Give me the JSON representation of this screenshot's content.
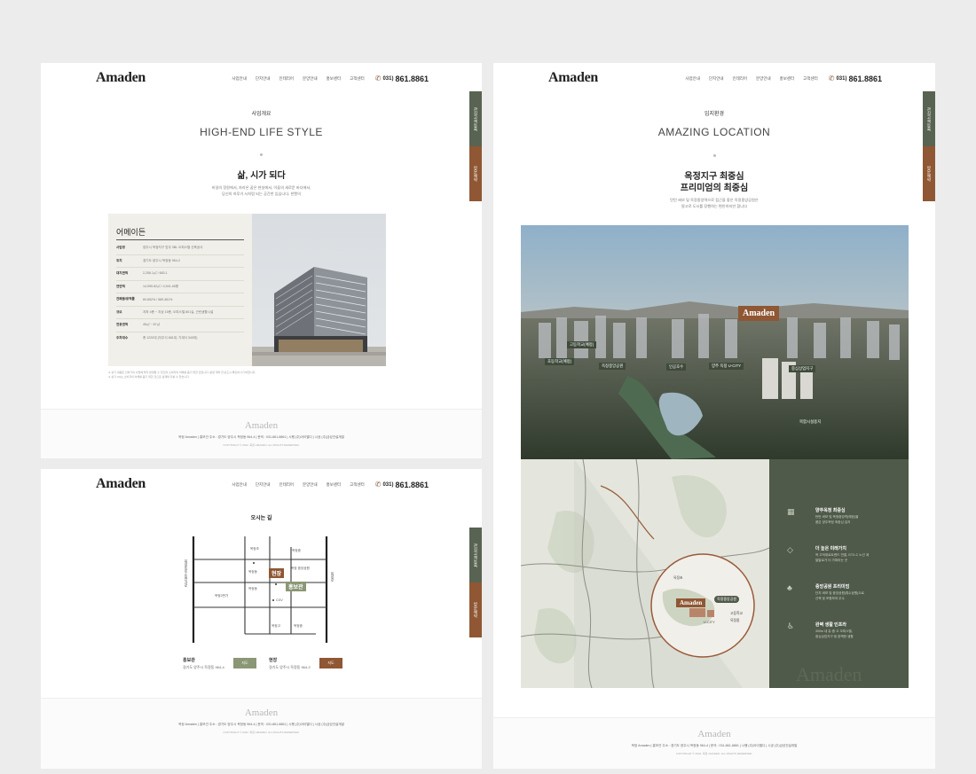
{
  "brand": {
    "logo": "Amaden",
    "nav": [
      "사업안내",
      "단지안내",
      "인테리어",
      "분양안내",
      "홍보센터",
      "고객센터"
    ],
    "phone_prefix": "031)",
    "phone_number": "861.8861"
  },
  "side_tabs": [
    "관심고객등록",
    "방문예약"
  ],
  "footer": {
    "logo": "Amaden",
    "info": "옥정 Amaden  |  홍보관 주소 : 경기도 양주시 옥정동 964-4  |  문의 : 031-861-8861  |  시행 (주)아이엘디  |  시공 (주)금성건설개발",
    "copyright": "COPYRIGHT © 2022. 옥정 AMADEN. ALL RIGHTS RESERVED."
  },
  "page1": {
    "section_label": "사업개요",
    "section_title": "HIGH-END LIFE STYLE",
    "headline": "삶, 시가 되다",
    "subtext": [
      "비일의 정원에서, 자라온 꿈은 현실에서, 이들의 새로운 바다에서,",
      "당신의 하루가 시처럼 되는 공간한 입습니다. 한캔의"
    ],
    "box_title": "어메이든",
    "rows": [
      {
        "k": "사업명",
        "v": "양주시 옥정지구 업무 3BL 오피스텔 신축공사"
      },
      {
        "k": "위치",
        "v": "경기도 양주시 옥정동 964-2"
      },
      {
        "k": "대지면적",
        "v": "2,256.1㎡ / 683.1"
      },
      {
        "k": "연면적",
        "v": "14,995.62㎡ / 4,541.46평"
      },
      {
        "k": "건폐율/용적률",
        "v": "69.652% / 589.481%"
      },
      {
        "k": "규모",
        "v": "지하 4층 ~ 지상 15층, 오피스텔 801실, 근린생활시설"
      },
      {
        "k": "전용면적",
        "v": "45㎡ ~ 67㎡"
      },
      {
        "k": "주차대수",
        "v": "총 1220대 (자주식 681대, 기계식 340대)"
      }
    ],
    "notes": [
      "※ 상기 내용은 인허가의 사업에 따라 변경될 수 있으며 소비자의 이해를 돕기 위한 것입니다. 분양 계약 전 반드시 확인하시기 바랍니다.",
      "※ 상기 CG는 소비자의 이해를 돕기 위한 것으로 실제와 다를 수 있습니다."
    ]
  },
  "page2": {
    "title": "오시는 길",
    "map_labels": {
      "site": "현장",
      "gallery": "홍보관",
      "left_road": "옥정동로-동안가로",
      "right_road": "옥정로",
      "top_a": "옥정초",
      "top_b": "옥정중",
      "park": "옥정 중앙공원",
      "left_place": "옥정2번가",
      "mid_place": "옥정동",
      "mid_place2": "옥정동",
      "bottom_a": "옥정고",
      "bottom_b": "옥정중",
      "cgv": "CGV"
    },
    "gallery": {
      "title": "홍보관",
      "address": "경기도 양주시 옥정동 964-4",
      "button": "지도"
    },
    "site": {
      "title": "현장",
      "address": "경기도 양주시 옥정동 964-2",
      "button": "지도"
    }
  },
  "page3": {
    "section_label": "입지환경",
    "section_title": "AMAZING LOCATION",
    "headline": [
      "옥정지구 최중심",
      "프리미엄의 최중심"
    ],
    "subtext": [
      "탄탄 써보 및 옥정중앙역으로 접근을 좋은 옥정중앙공원은",
      "말고로 도시를 장행하는 편안하지만 합니다"
    ],
    "aerial_logo": "Amaden",
    "aerial_labels": [
      "고등학교(예정)",
      "초등학교(예정)",
      "옥정중앙공원",
      "인공호수",
      "양주 옥정 U-CITY",
      "중심상업지구",
      "복합시설용지"
    ],
    "map_logo": "Amaden",
    "map_labels": [
      "옥정중앙공원",
      "옥정초",
      "고등학교",
      "U-CITY",
      "옥정중"
    ],
    "features": [
      {
        "icon": "city-icon",
        "title": "양주옥정 최중심",
        "desc": [
          "탄탄 써보 및 옥정중앙역(예정)을",
          "품은 양주옥정 최중심 입지"
        ]
      },
      {
        "icon": "gem-icon",
        "title": "더 높은 미래가치",
        "desc": [
          "옥 고덕위로트렌드 연결, GTX-C 노선 계",
          "발발로가 더 가파라는 곳"
        ]
      },
      {
        "icon": "park-icon",
        "title": "중앙공원 프리미엄",
        "desc": [
          "단지 써보 및 중앙공원(휴수공원)으로",
          "산책 및 포함하여 우수"
        ]
      },
      {
        "icon": "stroller-icon",
        "title": "완벽 생활 인프라",
        "desc": [
          "300m 내 유·중·고 오피스텔,",
          "중심상업지구 등 완벽한 생활"
        ]
      }
    ],
    "watermark": "Amaden"
  },
  "colors": {
    "green": "#596352",
    "brown": "#8f5734",
    "panel": "#4f5a4a",
    "beige": "#f0efe9"
  }
}
